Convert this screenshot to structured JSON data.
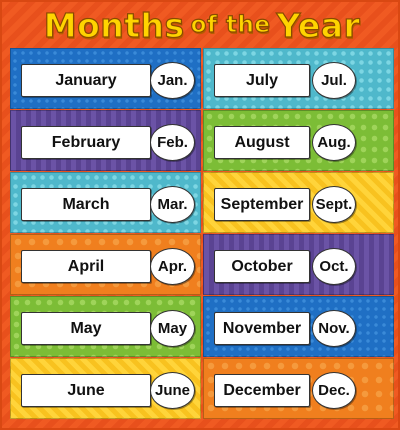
{
  "title": {
    "part1": "Months",
    "part2": "of the",
    "part3": "Year"
  },
  "colors": {
    "background": "#f05a22",
    "title": "#ffd400",
    "panels": [
      "blue",
      "purple",
      "teal",
      "orange",
      "green",
      "yellow"
    ]
  },
  "months_left": [
    {
      "name": "January",
      "abbr": "Jan."
    },
    {
      "name": "February",
      "abbr": "Feb."
    },
    {
      "name": "March",
      "abbr": "Mar."
    },
    {
      "name": "April",
      "abbr": "Apr."
    },
    {
      "name": "May",
      "abbr": "May"
    },
    {
      "name": "June",
      "abbr": "June"
    }
  ],
  "months_right": [
    {
      "name": "July",
      "abbr": "Jul."
    },
    {
      "name": "August",
      "abbr": "Aug."
    },
    {
      "name": "September",
      "abbr": "Sept."
    },
    {
      "name": "October",
      "abbr": "Oct."
    },
    {
      "name": "November",
      "abbr": "Nov."
    },
    {
      "name": "December",
      "abbr": "Dec."
    }
  ]
}
